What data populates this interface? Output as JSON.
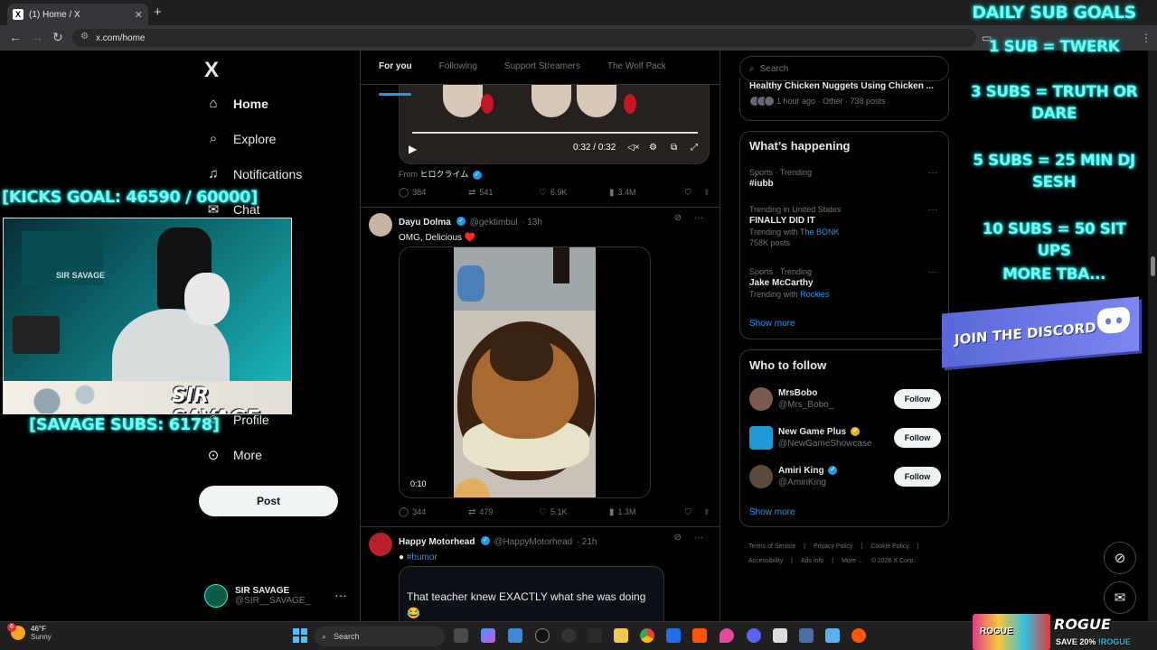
{
  "browser": {
    "tab_title": "(1) Home / X",
    "url": "x.com/home"
  },
  "nav": {
    "logo": "X",
    "items": [
      {
        "label": "Home",
        "icon": "home-icon"
      },
      {
        "label": "Explore",
        "icon": "search-icon"
      },
      {
        "label": "Notifications",
        "icon": "bell-icon"
      },
      {
        "label": "Chat",
        "icon": "mail-icon"
      },
      {
        "label": "Profile",
        "icon": "user-icon"
      },
      {
        "label": "More",
        "icon": "more-circle-icon"
      }
    ],
    "post_label": "Post",
    "account": {
      "name": "SIR SAVAGE",
      "handle": "@SIR__SAVAGE_"
    }
  },
  "timeline": {
    "tabs": [
      "For you",
      "Following",
      "Support Streamers",
      "The Wolf Pack"
    ],
    "active_tab": "For you",
    "tweet1": {
      "video_time": "0:32 / 0:32",
      "from_label": "From",
      "from_name": "ヒロクライム",
      "replies": "384",
      "reposts": "541",
      "likes": "6.9K",
      "views": "3.4M"
    },
    "tweet2": {
      "name": "Dayu Dolma",
      "handle": "@gektimbul",
      "time": "· 13h",
      "text": "OMG, Delicious ♥️",
      "video_duration": "0:10",
      "replies": "344",
      "reposts": "479",
      "likes": "5.1K",
      "views": "1.3M"
    },
    "tweet3": {
      "name": "Happy Motorhead",
      "handle": "@HappyMotorhead",
      "time": "· 21h",
      "hashtag": "#humor",
      "quote_text": "That teacher knew EXACTLY what she was doing 😂"
    }
  },
  "sidebar": {
    "search_placeholder": "Search",
    "story": {
      "title": "Healthy Chicken Nuggets Using Chicken ...",
      "meta": "1 hour ago · Other · 738 posts"
    },
    "whats_happening": "What’s happening",
    "trends": [
      {
        "context": "Sports · Trending",
        "name": "#iubb",
        "sub": "",
        "sub_link": ""
      },
      {
        "context": "Trending in United States",
        "name": "FINALLY DID IT",
        "sub": "Trending with",
        "sub_link": "The BONK",
        "posts": "758K posts"
      },
      {
        "context": "Sports · Trending",
        "name": "Jake McCarthy",
        "sub": "Trending with",
        "sub_link": "Rockies"
      }
    ],
    "show_more": "Show more",
    "who_to_follow": "Who to follow",
    "follow_label": "Follow",
    "suggestions": [
      {
        "name": "MrsBobo",
        "handle": "@Mrs_Bobo_",
        "color": "#7a5c4e"
      },
      {
        "name": "New Game Plus",
        "handle": "@NewGameShowcase",
        "color": "#1e9bd7"
      },
      {
        "name": "Amiri King",
        "handle": "@AmiriKing",
        "color": "#5a4a3e"
      }
    ],
    "footer": [
      "Terms of Service",
      "|",
      "Privacy Policy",
      "|",
      "Cookie Policy",
      "|",
      "Accessibility",
      "|",
      "Ads info",
      "|",
      "More ...",
      "© 2026 X Corp."
    ]
  },
  "overlay": {
    "title": "DAILY SUB GOALS",
    "goals": [
      "1 SUB = TWERK",
      "3 SUBS = TRUTH OR DARE",
      "5 SUBS = 25 MIN DJ SESH",
      "10 SUBS = 50 SIT UPS",
      "MORE TBA..."
    ],
    "discord": "JOIN THE DISCORD",
    "kicks_goal": "[KICKS GOAL:  46590 / 60000]",
    "savage_subs": "[SAVAGE SUBS: 6178]",
    "webcam_brand": "SIR SAVAGE",
    "webcam_badge": "SIR SAVAGE"
  },
  "taskbar": {
    "temp": "46°F",
    "condition": "Sunny",
    "badge": "6",
    "search": "Search"
  },
  "promo": {
    "cans_text": "ROGUE",
    "logo": "ROGUE",
    "save": "SAVE 20%",
    "code": "!ROGUE"
  },
  "colors": {
    "accent": "#1d9bf0",
    "neon": "#7cf4f0",
    "discord": "#5a67d8"
  }
}
